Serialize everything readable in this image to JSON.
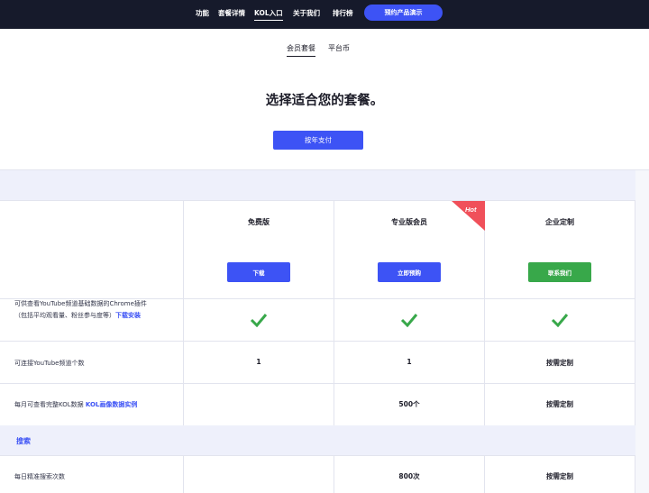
{
  "nav": {
    "items": [
      "功能",
      "套餐详情",
      "KOL入口",
      "关于我们",
      "排行榜"
    ],
    "active_index": 2,
    "demo_button": "预约产品演示"
  },
  "subtabs": [
    "会员套餐",
    "平台币"
  ],
  "headline": "选择适合您的套餐。",
  "billing_button": "按年支付",
  "plans": [
    {
      "name": "免费版",
      "button": "下载",
      "button_color": "#3d53f5"
    },
    {
      "name": "专业版会员",
      "button": "立即预购",
      "button_color": "#3d53f5",
      "ribbon": "Hot"
    },
    {
      "name": "企业定制",
      "button": "联系我们",
      "button_color": "#38a84a"
    }
  ],
  "rows": [
    {
      "feature_line1": "可供查看YouTube频道基础数据的Chrome插件",
      "feature_line2": "（包括平均观看量、粉丝参与度等）",
      "feature_link": "下载安装",
      "values": [
        "check-icon",
        "check-icon",
        "check-icon"
      ]
    },
    {
      "feature": "可连接YouTube频道个数",
      "values": [
        "1",
        "1",
        "按需定制"
      ]
    },
    {
      "feature": "每月可查看完整KOL数据",
      "feature_link": "KOL画像数据实例",
      "values": [
        "",
        "500个",
        "按需定制"
      ]
    },
    {
      "section": "搜索"
    },
    {
      "feature": "每日精准搜索次数",
      "values": [
        "",
        "800次",
        "按需定制"
      ]
    }
  ],
  "colors": {
    "nav_bg": "#161a2b",
    "primary": "#3d53f5",
    "green": "#38a84a",
    "hot": "#f0505a",
    "band": "#eef0fb"
  }
}
